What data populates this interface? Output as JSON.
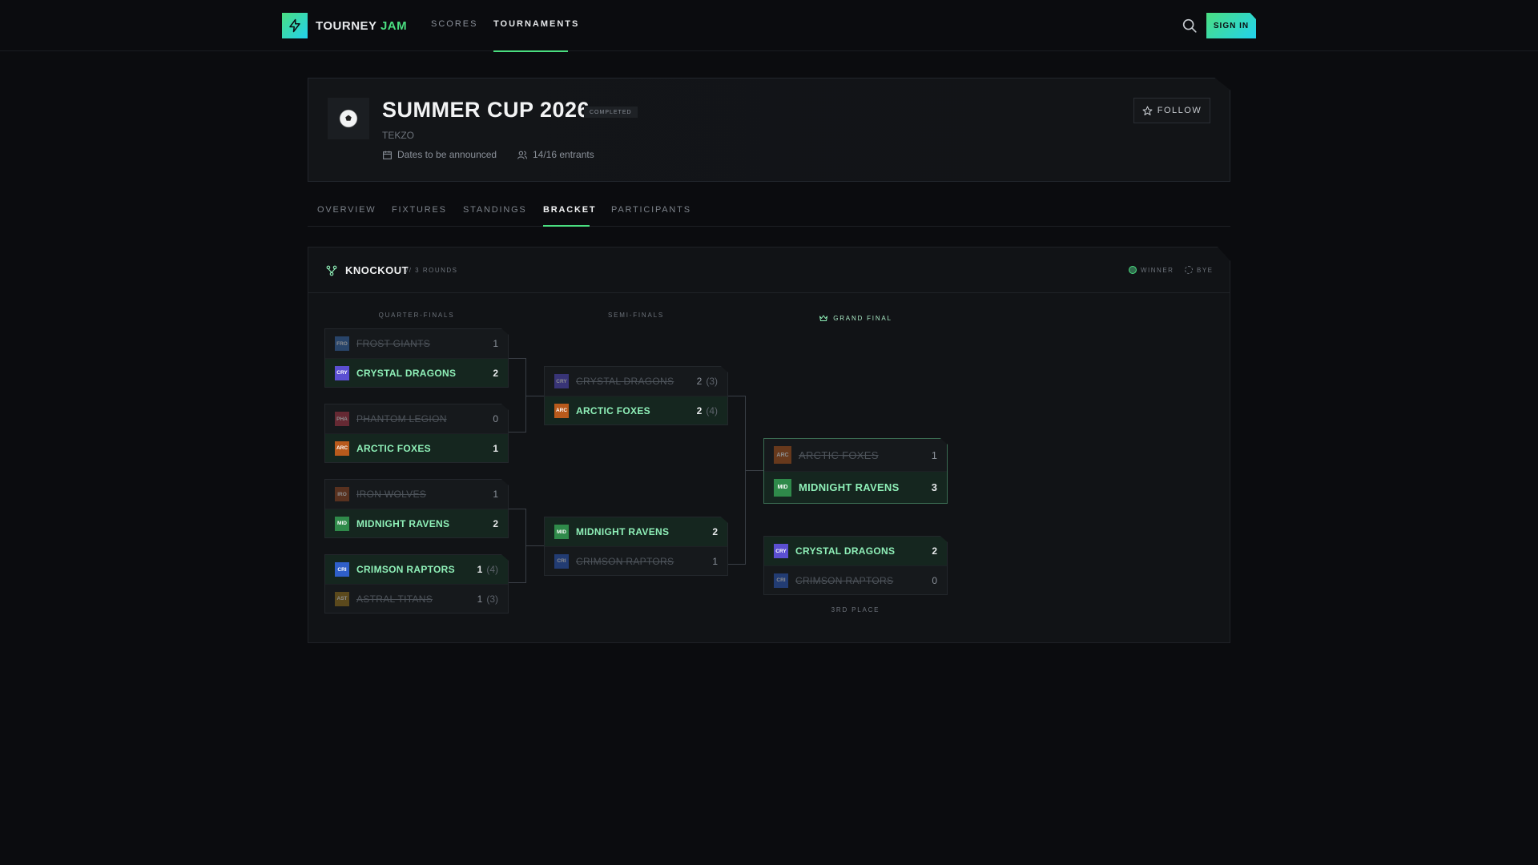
{
  "brand": {
    "name_part1": "TOURNEY",
    "name_part2": "JAM"
  },
  "nav": {
    "scores": "SCORES",
    "tournaments": "TOURNAMENTS",
    "signin": "SIGN IN"
  },
  "tournament": {
    "icon": "soccer-ball-icon",
    "title": "SUMMER CUP 2026",
    "status": "COMPLETED",
    "organizer": "TEKZO",
    "dates": "Dates to be announced",
    "entrants": "14/16 entrants",
    "follow": "FOLLOW"
  },
  "tabs": [
    "OVERVIEW",
    "FIXTURES",
    "STANDINGS",
    "BRACKET",
    "PARTICIPANTS"
  ],
  "bracket": {
    "title": "KNOCKOUT",
    "subtitle": "// 3 ROUNDS",
    "legend_winner": "WINNER",
    "legend_bye": "BYE",
    "round_qf": "QUARTER-FINALS",
    "round_sf": "SEMI-FINALS",
    "round_gf": "GRAND FINAL",
    "third_place": "3RD PLACE",
    "qf": [
      {
        "t1": {
          "abbr": "FRO",
          "name": "FROST GIANTS",
          "score": "1",
          "pen": "",
          "color": "#3b6fb6",
          "result": "lose"
        },
        "t2": {
          "abbr": "CRY",
          "name": "CRYSTAL DRAGONS",
          "score": "2",
          "pen": "",
          "color": "#5b4fd1",
          "result": "win"
        }
      },
      {
        "t1": {
          "abbr": "PHA",
          "name": "PHANTOM LEGION",
          "score": "0",
          "pen": "",
          "color": "#b43a4a",
          "result": "lose"
        },
        "t2": {
          "abbr": "ARC",
          "name": "ARCTIC FOXES",
          "score": "1",
          "pen": "",
          "color": "#b85a1c",
          "result": "win"
        }
      },
      {
        "t1": {
          "abbr": "IRO",
          "name": "IRON WOLVES",
          "score": "1",
          "pen": "",
          "color": "#9a4a22",
          "result": "lose"
        },
        "t2": {
          "abbr": "MID",
          "name": "MIDNIGHT RAVENS",
          "score": "2",
          "pen": "",
          "color": "#2f8a4a",
          "result": "win"
        }
      },
      {
        "t1": {
          "abbr": "CRI",
          "name": "CRIMSON RAPTORS",
          "score": "1",
          "pen": "(4)",
          "color": "#2f5fc9",
          "result": "win"
        },
        "t2": {
          "abbr": "AST",
          "name": "ASTRAL TITANS",
          "score": "1",
          "pen": "(3)",
          "color": "#a07a1c",
          "result": "lose"
        }
      }
    ],
    "sf": [
      {
        "t1": {
          "abbr": "CRY",
          "name": "CRYSTAL DRAGONS",
          "score": "2",
          "pen": "(3)",
          "color": "#5b4fd1",
          "result": "lose"
        },
        "t2": {
          "abbr": "ARC",
          "name": "ARCTIC FOXES",
          "score": "2",
          "pen": "(4)",
          "color": "#b85a1c",
          "result": "win"
        }
      },
      {
        "t1": {
          "abbr": "MID",
          "name": "MIDNIGHT RAVENS",
          "score": "2",
          "pen": "",
          "color": "#2f8a4a",
          "result": "win"
        },
        "t2": {
          "abbr": "CRI",
          "name": "CRIMSON RAPTORS",
          "score": "1",
          "pen": "",
          "color": "#2f5fc9",
          "result": "lose"
        }
      }
    ],
    "gf": {
      "t1": {
        "abbr": "ARC",
        "name": "ARCTIC FOXES",
        "score": "1",
        "pen": "",
        "color": "#b85a1c",
        "result": "lose"
      },
      "t2": {
        "abbr": "MID",
        "name": "MIDNIGHT RAVENS",
        "score": "3",
        "pen": "",
        "color": "#2f8a4a",
        "result": "win"
      }
    },
    "third": {
      "t1": {
        "abbr": "CRY",
        "name": "CRYSTAL DRAGONS",
        "score": "2",
        "pen": "",
        "color": "#5b4fd1",
        "result": "win"
      },
      "t2": {
        "abbr": "CRI",
        "name": "CRIMSON RAPTORS",
        "score": "0",
        "pen": "",
        "color": "#2f5fc9",
        "result": "lose"
      }
    }
  }
}
